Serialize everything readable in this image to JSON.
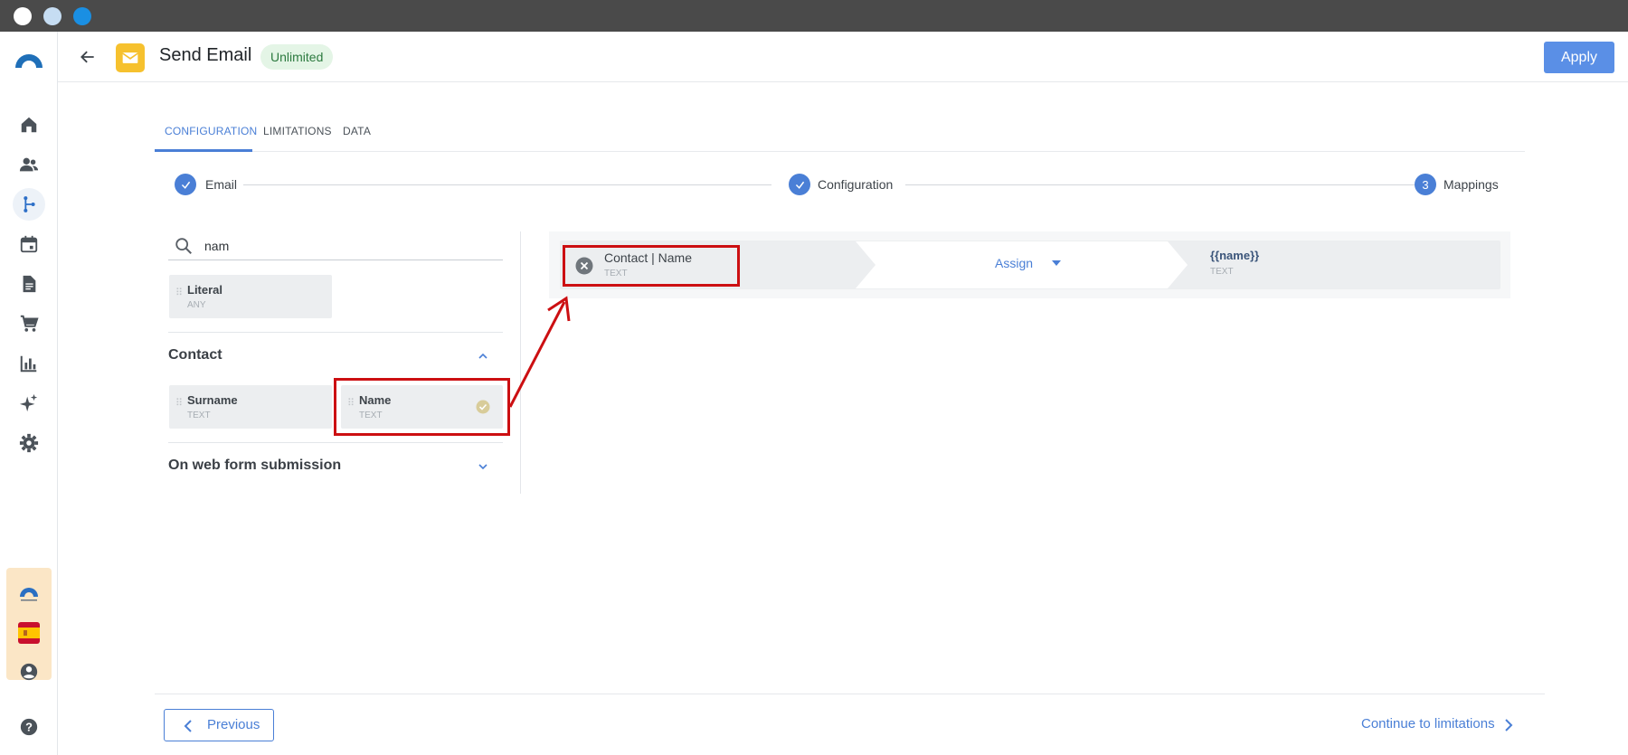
{
  "header": {
    "title": "Send Email",
    "badge": "Unlimited",
    "apply_label": "Apply"
  },
  "tabs": [
    {
      "label": "CONFIGURATION",
      "active": true
    },
    {
      "label": "LIMITATIONS",
      "active": false
    },
    {
      "label": "DATA",
      "active": false
    }
  ],
  "stepper": [
    {
      "label": "Email",
      "state": "done"
    },
    {
      "label": "Configuration",
      "state": "done"
    },
    {
      "label": "Mappings",
      "state": "current",
      "number": "3"
    }
  ],
  "search": {
    "value": "nam"
  },
  "fields": {
    "literal": {
      "name": "Literal",
      "type": "ANY"
    },
    "contact_section": {
      "title": "Contact",
      "items": [
        {
          "name": "Surname",
          "type": "TEXT"
        },
        {
          "name": "Name",
          "type": "TEXT",
          "mapped": true
        }
      ]
    },
    "webform_section": {
      "title": "On web form submission"
    }
  },
  "mapping": {
    "source_name": "Contact | Name",
    "source_type": "TEXT",
    "operation": "Assign",
    "target_name": "{{name}}",
    "target_type": "TEXT"
  },
  "footer": {
    "previous_label": "Previous",
    "next_label": "Continue to limitations"
  },
  "colors": {
    "accent": "#4a7fd6",
    "apply": "#5a8fe6",
    "annotation": "#cc0f12",
    "app_icon": "#f6c12e"
  },
  "icons": {
    "rail": [
      "home-icon",
      "contacts-icon",
      "workflow-icon",
      "calendar-icon",
      "document-icon",
      "cart-icon",
      "chart-icon",
      "sparkle-icon",
      "settings-icon",
      "account-icon",
      "help-icon"
    ]
  }
}
